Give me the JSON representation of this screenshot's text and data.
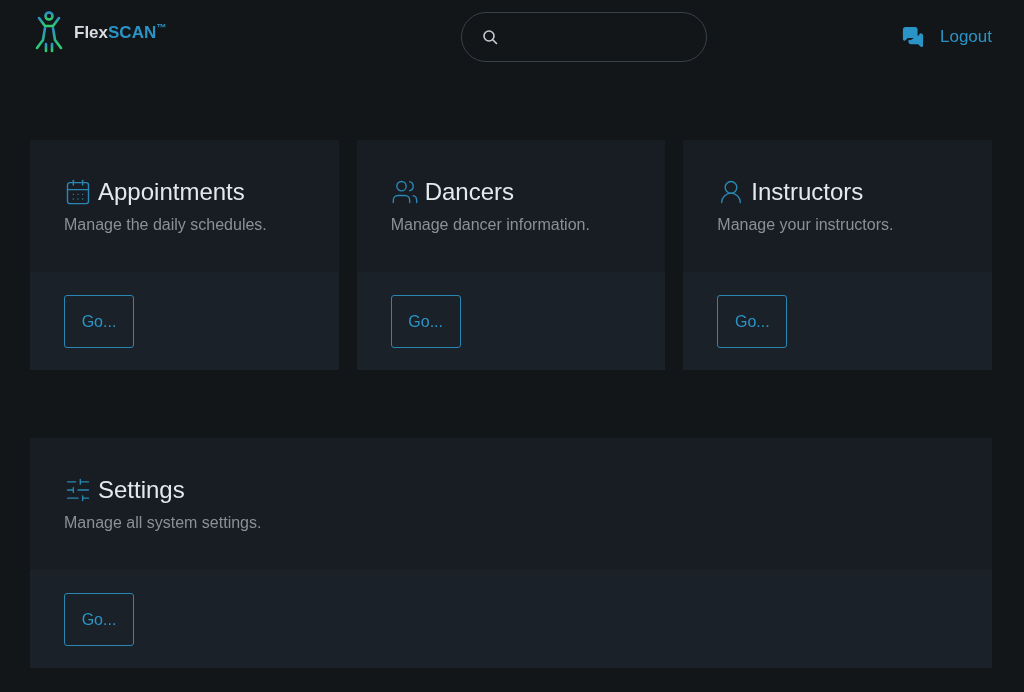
{
  "logo": {
    "name": "Flex",
    "accent": "SCAN",
    "mark": "™"
  },
  "header_actions": {
    "logout": "Logout"
  },
  "cards": [
    {
      "kind": "calendar",
      "title": "Appointments",
      "description": "Manage the daily schedules.",
      "button": "Go..."
    },
    {
      "kind": "users",
      "title": "Dancers",
      "description": "Manage dancer information.",
      "button": "Go..."
    },
    {
      "kind": "user",
      "title": "Instructors",
      "description": "Manage your instructors.",
      "button": "Go..."
    },
    {
      "kind": "sliders",
      "title": "Settings",
      "description": "Manage all system settings.",
      "button": "Go..."
    }
  ]
}
